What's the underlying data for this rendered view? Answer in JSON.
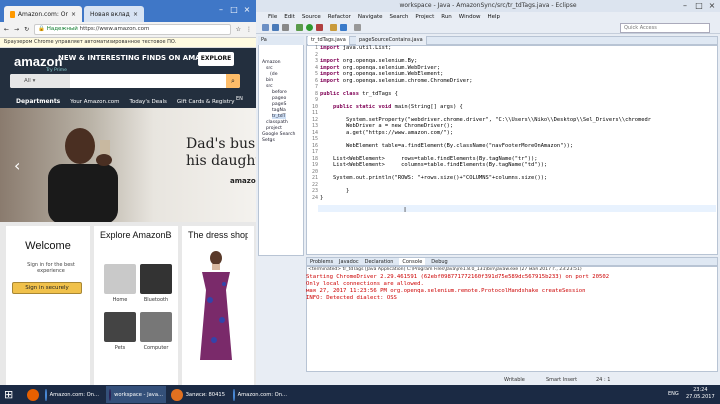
{
  "chrome": {
    "tab1": "Amazon.com: Online Sh",
    "tab2": "Новая вкладка",
    "secure_label": "Надежный",
    "url": "https://www.amazon.com",
    "infobar_text": "Браузером Chrome управляет автоматизированное тестовое ПО."
  },
  "amazon": {
    "logo": "amazon",
    "logo_sub": "Try Prime",
    "promo": "NEW & INTERESTING FINDS ON AMAZON",
    "explore": "EXPLORE",
    "search_all": "All",
    "nav": [
      "Departments",
      "Your Amazon.com",
      "Today's Deals",
      "Gift Cards & Registry"
    ],
    "lang": "EN",
    "hero_line1": "Dad's bus",
    "hero_line2": "his daughte",
    "hero_brand": "amazon",
    "welcome_title": "Welcome",
    "welcome_sub": "Sign in for the best experience",
    "signin": "Sign in securely",
    "explore_title": "Explore AmazonBas...",
    "explore_items": [
      "Home",
      "Bluetooth",
      "Pets",
      "Computer"
    ],
    "dress_title": "The dress shop"
  },
  "eclipse": {
    "title": "workspace - Java - AmazonSync/src/tr_tdTags.java - Eclipse",
    "menu": [
      "File",
      "Edit",
      "Source",
      "Refactor",
      "Navigate",
      "Search",
      "Project",
      "Run",
      "Window",
      "Help"
    ],
    "quick_access": "Quick Access",
    "pkg_tab": "Pa",
    "tree": [
      "Amazon",
      "src",
      "(de",
      "bin",
      "src",
      "before",
      "pageo",
      "pageS",
      "tagNa",
      "tr_tdT",
      "classpath",
      "project",
      "Google Search",
      "Setgs"
    ],
    "editor_tabs": [
      "tr_tdTags.java",
      "pageSourceContains.java"
    ],
    "line_numbers": [
      "1",
      "2",
      "3",
      "4",
      "5",
      "6",
      "7",
      "8",
      "9",
      "10",
      "11",
      "12",
      "13",
      "14",
      "15",
      "16",
      "17",
      "18",
      "19",
      "20",
      "21",
      "22",
      "23",
      "24"
    ],
    "code": [
      {
        "kw": "import",
        "rest": " java.util.List;"
      },
      {
        "kw": "",
        "rest": ""
      },
      {
        "kw": "import",
        "rest": " org.openqa.selenium.By;"
      },
      {
        "kw": "import",
        "rest": " org.openqa.selenium.WebDriver;"
      },
      {
        "kw": "import",
        "rest": " org.openqa.selenium.WebElement;"
      },
      {
        "kw": "import",
        "rest": " org.openqa.selenium.chrome.ChromeDriver;"
      },
      {
        "kw": "",
        "rest": ""
      },
      {
        "kw": "public class",
        "rest": " tr_tdTags {"
      },
      {
        "kw": "",
        "rest": ""
      },
      {
        "kw": "    public static void",
        "rest": " main(String[] args) {"
      },
      {
        "kw": "",
        "rest": ""
      },
      {
        "kw": "",
        "rest": "        System.setProperty(\"webdriver.chrome.driver\", \"C:\\\\Users\\\\Niko\\\\Desktop\\\\Sel_Drivers\\\\chromedr"
      },
      {
        "kw": "",
        "rest": "        WebDriver a = new ChromeDriver();"
      },
      {
        "kw": "",
        "rest": "        a.get(\"https://www.amazon.com/\");"
      },
      {
        "kw": "",
        "rest": ""
      },
      {
        "kw": "",
        "rest": "        WebElement table=a.findElement(By.className(\"navFooterMoreOnAmazon\"));"
      },
      {
        "kw": "",
        "rest": ""
      },
      {
        "kw": "",
        "rest": "    List<WebElement>     rows=table.findElements(By.tagName(\"tr\"));"
      },
      {
        "kw": "",
        "rest": "    List<WebElement>     columns=table.findElements(By.tagName(\"td\"));"
      },
      {
        "kw": "",
        "rest": ""
      },
      {
        "kw": "",
        "rest": "    System.out.println(\"ROWS: \"+rows.size()+\"COLUMNS\"+columns.size());"
      },
      {
        "kw": "",
        "rest": ""
      },
      {
        "kw": "",
        "rest": "        }"
      },
      {
        "kw": "",
        "rest": "}"
      }
    ],
    "console_tabs": [
      "Problems",
      "Javadoc",
      "Declaration",
      "Console",
      "Debug"
    ],
    "console_header": "<terminated> tr_tdTags [Java Application] C:\\Program Files\\Java\\jre1.8.0_131\\bin\\javaw.exe (27 мая 2017 г., 23:23:51)",
    "console_lines": [
      "Starting ChromeDriver 2.29.461591 (62ebf098771772160f391d75e589dc567915b233) on port 20502",
      "Only local connections are allowed.",
      "мая 27, 2017 11:23:56 PM org.openqa.selenium.remote.ProtocolHandshake createSession",
      "INFO: Detected dialect: OSS"
    ],
    "status_writable": "Writable",
    "status_insert": "Smart Insert",
    "status_pos": "24 : 1"
  },
  "taskbar": {
    "items": [
      "Amazon.com: On...",
      "workspace - Java...",
      "Записи: 80415",
      "Amazon.com: On..."
    ],
    "lang": "ENG",
    "time": "23:24",
    "date": "27.05.2017"
  },
  "colors": {
    "amazon_dark": "#232f3e",
    "amazon_orange": "#febd69",
    "eclipse_bg": "#e8edf4",
    "taskbar": "#1b2a44"
  }
}
